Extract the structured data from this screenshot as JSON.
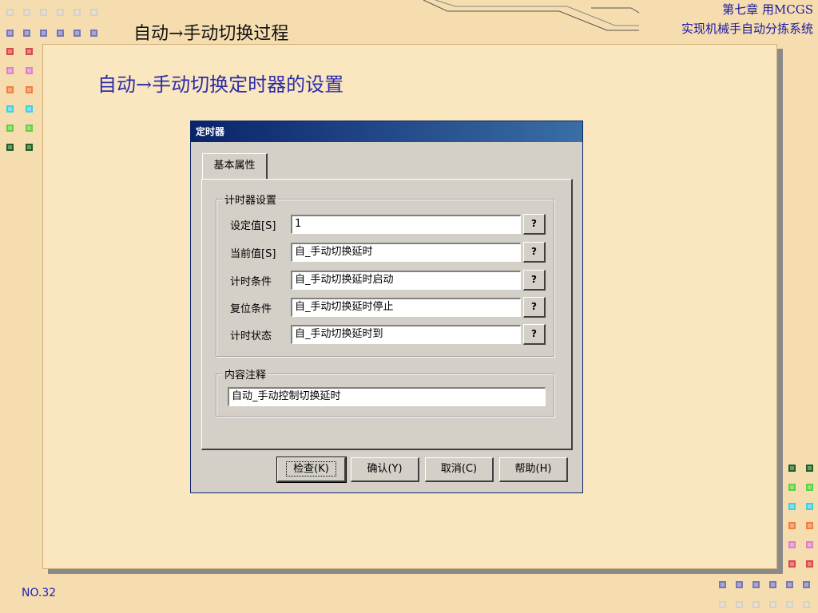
{
  "colors": {
    "background": "#f5ddb0",
    "panel": "#fae6bf",
    "heading": "#2c2ca8",
    "dialog_title": "#0a246a"
  },
  "slide": {
    "title": "自动→手动切换过程",
    "chapter_line1": "第七章 用MCGS",
    "chapter_line2": "实现机械手自动分拣系统",
    "content_heading": "自动→手动切换定时器的设置",
    "page_number": "NO.32"
  },
  "dialog": {
    "title": "定时器",
    "tab_label": "基本属性",
    "timer_group_label": "计时器设置",
    "rows": [
      {
        "label": "设定值[S]",
        "value": "1",
        "button": "?"
      },
      {
        "label": "当前值[S]",
        "value": "自_手动切换延时",
        "button": "?"
      },
      {
        "label": "计时条件",
        "value": "自_手动切换延时启动",
        "button": "?"
      },
      {
        "label": "复位条件",
        "value": "自_手动切换延时停止",
        "button": "?"
      },
      {
        "label": "计时状态",
        "value": "自_手动切换延时到",
        "button": "?"
      }
    ],
    "comment_group_label": "内容注释",
    "comment_value": "自动_手动控制切换延时",
    "buttons": {
      "check": "检查(K)",
      "confirm": "确认(Y)",
      "cancel": "取消(C)",
      "help": "帮助(H)"
    }
  }
}
